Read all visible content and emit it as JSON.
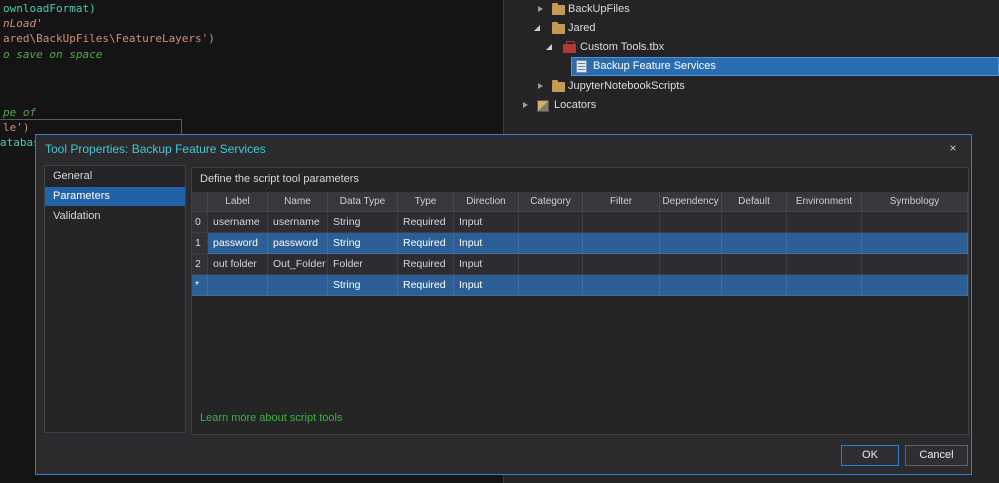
{
  "editor": {
    "lines": [
      {
        "text": "ownloadFormat)"
      },
      {
        "text": "nLoad'"
      },
      {
        "text": "ared\\BackUpFiles\\FeatureLayers')"
      },
      {
        "text": "o save on space"
      },
      {
        "text": "pe of"
      },
      {
        "text": "le')"
      },
      {
        "text": "atabase"
      }
    ]
  },
  "catalog": {
    "items": [
      {
        "label": "BackUpFiles"
      },
      {
        "label": "Jared"
      },
      {
        "label": "Custom Tools.tbx"
      },
      {
        "label": "Backup Feature Services"
      },
      {
        "label": "JupyterNotebookScripts"
      },
      {
        "label": "Locators"
      }
    ]
  },
  "dialog": {
    "title": "Tool Properties: Backup Feature Services",
    "subtitle": "Define the script tool parameters",
    "link": "Learn more about script tools",
    "ok": "OK",
    "cancel": "Cancel",
    "sidebar": [
      {
        "label": "General"
      },
      {
        "label": "Parameters"
      },
      {
        "label": "Validation"
      }
    ],
    "table": {
      "headers": [
        "",
        "Label",
        "Name",
        "Data Type",
        "Type",
        "Direction",
        "Category",
        "Filter",
        "Dependency",
        "Default",
        "Environment",
        "Symbology"
      ],
      "rows": [
        {
          "num": "0",
          "label": "username",
          "name": "username",
          "data_type": "String",
          "type": "Required",
          "direction": "Input"
        },
        {
          "num": "1",
          "label": "password",
          "name": "password",
          "data_type": "String",
          "type": "Required",
          "direction": "Input"
        },
        {
          "num": "2",
          "label": "out folder",
          "name": "Out_Folder",
          "data_type": "Folder",
          "type": "Required",
          "direction": "Input"
        },
        {
          "num": "*",
          "label": "",
          "name": "",
          "data_type": "String",
          "type": "Required",
          "direction": "Input"
        }
      ]
    }
  },
  "icons": {
    "close": "×"
  },
  "colors": {
    "accent_blue": "#2e7ed4",
    "tree_selection_blue": "#2a6cb0",
    "row_selection_blue": "#2d5f97",
    "sidebar_selection_blue": "#2263a8",
    "title_teal": "#3ec9d6",
    "link_green": "#3fae46",
    "comment_green": "#57a64a",
    "string_orange": "#ce9178",
    "code_teal": "#4ec9b0"
  }
}
